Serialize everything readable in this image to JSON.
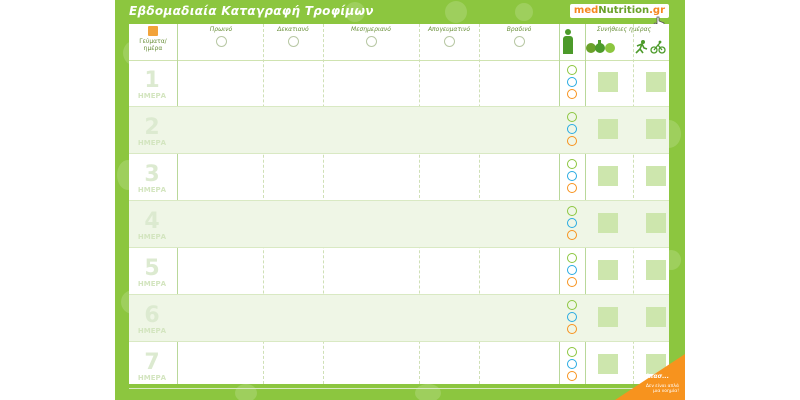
{
  "header": {
    "title": "Εβδομαδιαία Καταγραφή Τροφίμων",
    "logo_prefix": "med",
    "logo_main": "Nutrition",
    "logo_suffix": ".gr"
  },
  "columns": {
    "day": "Γεύματα/ ημέρα",
    "meals": [
      "Πρωινό",
      "Δεκατιανό",
      "Μεσημεριανό",
      "Απογευματινό",
      "Βραδινό"
    ],
    "habits": "Συνήθειες ημέρας"
  },
  "days": [
    {
      "num": "1",
      "word": "ΗΜΕΡΑ"
    },
    {
      "num": "2",
      "word": "ΗΜΕΡΑ"
    },
    {
      "num": "3",
      "word": "ΗΜΕΡΑ"
    },
    {
      "num": "4",
      "word": "ΗΜΕΡΑ"
    },
    {
      "num": "5",
      "word": "ΗΜΕΡΑ"
    },
    {
      "num": "6",
      "word": "ΗΜΕΡΑ"
    },
    {
      "num": "7",
      "word": "ΗΜΕΡΑ"
    }
  ],
  "corner": {
    "line1": "Λίπασ...",
    "line2": "Δεν είναι απλά μια νοημία!"
  },
  "colors": {
    "frame": "#8cc63f",
    "accent_orange": "#f7931e",
    "accent_blue": "#29abe2"
  },
  "icons": [
    "calendar-icon",
    "alarm-clock-icon",
    "person-icon",
    "vegetables-icon",
    "running-icon",
    "cycling-icon",
    "smiley-face-icon"
  ]
}
